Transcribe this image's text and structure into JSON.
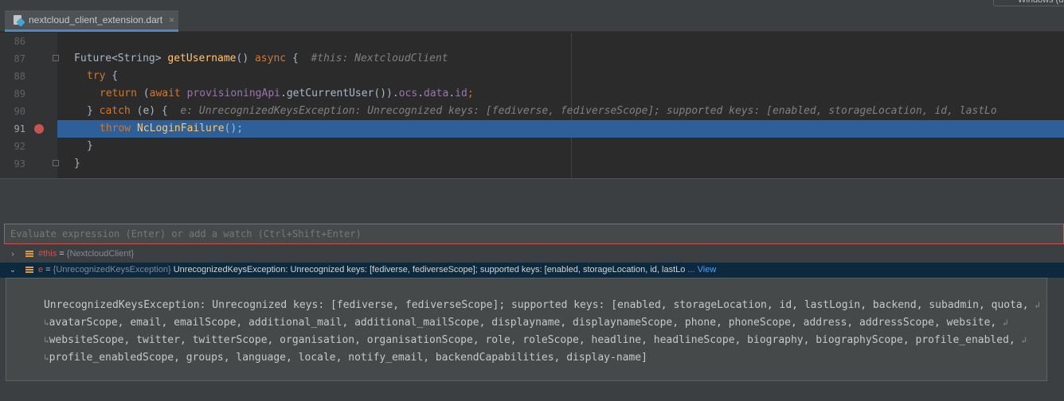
{
  "tab": {
    "file_name": "nextcloud_client_extension.dart",
    "close": "×"
  },
  "top_right": {
    "label": "Windows (d"
  },
  "editor": {
    "lines": [
      {
        "num": "86"
      },
      {
        "num": "87"
      },
      {
        "num": "88"
      },
      {
        "num": "89"
      },
      {
        "num": "90"
      },
      {
        "num": "91"
      },
      {
        "num": "92"
      },
      {
        "num": "93"
      }
    ],
    "code": {
      "l87_type": "Future<String> ",
      "l87_fn": "getUsername",
      "l87_paren": "() ",
      "l87_async": "async",
      "l87_brace": " {  ",
      "l87_hint": "#this: NextcloudClient",
      "l88_try": "try",
      "l88_brace": " {",
      "l89_return": "return",
      "l89_open": " (",
      "l89_await": "await",
      "l89_sp": " ",
      "l89_api": "provisioningApi",
      "l89_call": ".getCurrentUser()).",
      "l89_ocs": "ocs",
      "l89_dot1": ".",
      "l89_data": "data",
      "l89_dot2": ".",
      "l89_id": "id",
      "l89_end": ";",
      "l90_close": "} ",
      "l90_catch": "catch",
      "l90_e": " (e) {  ",
      "l90_hint": "e: UnrecognizedKeysException: Unrecognized keys: [fediverse, fediverseScope]; supported keys: [enabled, storageLocation, id, lastLo",
      "l91_throw": "throw",
      "l91_sp": " ",
      "l91_fn": "NcLoginFailure",
      "l91_end": "();",
      "l92_close": "}",
      "l93_close": "}"
    }
  },
  "debugger": {
    "eval_placeholder": "Evaluate expression (Enter) or add a watch (Ctrl+Shift+Enter)",
    "vars": [
      {
        "chevron": "›",
        "name": "#this",
        "eq": " = ",
        "type": "{NextcloudClient}",
        "value": "",
        "link": ""
      },
      {
        "chevron": "⌄",
        "name": "e",
        "eq": " = ",
        "type": "{UnrecognizedKeysException} ",
        "value": "UnrecognizedKeysException: Unrecognized keys: [fediverse, fediverseScope]; supported keys: [enabled, storageLocation, id, lastLo",
        "link": " ... View"
      }
    ],
    "value_lines": [
      "UnrecognizedKeysException: Unrecognized keys: [fediverse, fediverseScope]; supported keys: [enabled, storageLocation, id, lastLogin, backend, subadmin, quota,",
      "avatarScope, email, emailScope, additional_mail, additional_mailScope, displayname, displaynameScope, phone, phoneScope, address, addressScope, website,",
      "websiteScope, twitter, twitterScope, organisation, organisationScope, role, roleScope, headline, headlineScope, biography, biographyScope, profile_enabled,",
      "profile_enabledScope, groups, language, locale, notify_email, backendCapabilities, display-name]"
    ],
    "wrap_in": "↳",
    "wrap_out": "↲"
  }
}
